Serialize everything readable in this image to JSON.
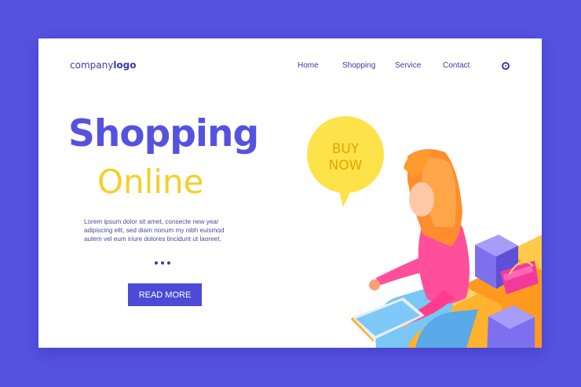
{
  "header": {
    "logo_prefix": "company",
    "logo_bold": "logo",
    "nav": [
      {
        "label": "Home"
      },
      {
        "label": "Shopping"
      },
      {
        "label": "Service"
      },
      {
        "label": "Contact"
      }
    ],
    "search_icon": "search-icon"
  },
  "hero": {
    "title": "Shopping",
    "subtitle": "Online",
    "body_lines": [
      "Lorem ipsum dolor sit amet, consecte new year",
      "adipiscing elit, sed diam nonum my nibh euismod",
      "autem vel eum iriure dolores tincidunt ut laoreet."
    ],
    "button_label": "READ MORE"
  },
  "illustration": {
    "bubble_line1": "BUY",
    "bubble_line2": "NOW"
  },
  "colors": {
    "background": "#5552e0",
    "title": "#5552e0",
    "subtitle": "#f5cf2a",
    "button": "#4e4ad8"
  }
}
